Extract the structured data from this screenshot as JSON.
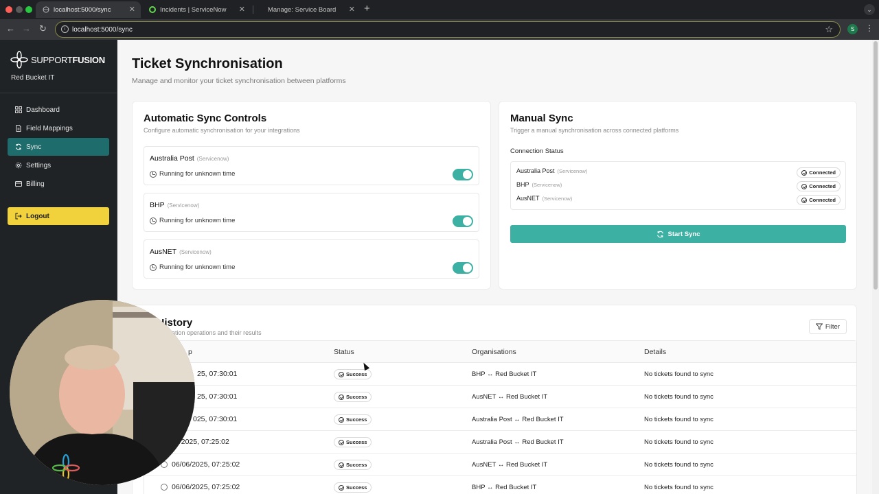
{
  "browser": {
    "tabs": [
      {
        "title": "localhost:5000/sync",
        "active": true
      },
      {
        "title": "Incidents | ServiceNow",
        "active": false
      },
      {
        "title": "Manage: Service Board",
        "active": false
      }
    ],
    "url": "localhost:5000/sync",
    "profile_initial": "S"
  },
  "sidebar": {
    "brand_light": "SUPPORT",
    "brand_bold": "FUSION",
    "org": "Red Bucket IT",
    "items": [
      {
        "label": "Dashboard",
        "icon": "grid-icon",
        "active": false
      },
      {
        "label": "Field Mappings",
        "icon": "document-icon",
        "active": false
      },
      {
        "label": "Sync",
        "icon": "refresh-icon",
        "active": true
      },
      {
        "label": "Settings",
        "icon": "gear-icon",
        "active": false
      },
      {
        "label": "Billing",
        "icon": "credit-card-icon",
        "active": false
      }
    ],
    "logout_label": "Logout"
  },
  "page": {
    "title": "Ticket Synchronisation",
    "subtitle": "Manage and monitor your ticket synchronisation between platforms"
  },
  "auto_sync": {
    "title": "Automatic Sync Controls",
    "subtitle": "Configure automatic synchronisation for your integrations",
    "integrations": [
      {
        "name": "Australia Post",
        "type": "(Servicenow)",
        "status": "Running for unknown time",
        "enabled": true
      },
      {
        "name": "BHP",
        "type": "(Servicenow)",
        "status": "Running for unknown time",
        "enabled": true
      },
      {
        "name": "AusNET",
        "type": "(Servicenow)",
        "status": "Running for unknown time",
        "enabled": true
      }
    ]
  },
  "manual_sync": {
    "title": "Manual Sync",
    "subtitle": "Trigger a manual synchronisation across connected platforms",
    "connection_label": "Connection Status",
    "connections": [
      {
        "name": "Australia Post",
        "type": "(Servicenow)",
        "status": "Connected"
      },
      {
        "name": "BHP",
        "type": "(Servicenow)",
        "status": "Connected"
      },
      {
        "name": "AusNET",
        "type": "(Servicenow)",
        "status": "Connected"
      }
    ],
    "start_label": "Start Sync"
  },
  "history": {
    "title": "c History",
    "subtitle": "nchronisation operations and their results",
    "filter_label": "Filter",
    "columns": [
      "p",
      "Status",
      "Organisations",
      "Details"
    ],
    "rows": [
      {
        "timestamp": "25, 07:30:01",
        "status": "Success",
        "orgs": "BHP ↔ Red Bucket IT",
        "details": "No tickets found to sync"
      },
      {
        "timestamp": "25, 07:30:01",
        "status": "Success",
        "orgs": "AusNET ↔ Red Bucket IT",
        "details": "No tickets found to sync"
      },
      {
        "timestamp": "025, 07:30:01",
        "status": "Success",
        "orgs": "Australia Post ↔ Red Bucket IT",
        "details": "No tickets found to sync"
      },
      {
        "timestamp": "6/2025, 07:25:02",
        "status": "Success",
        "orgs": "Australia Post ↔ Red Bucket IT",
        "details": "No tickets found to sync"
      },
      {
        "timestamp": "06/06/2025, 07:25:02",
        "status": "Success",
        "orgs": "AusNET ↔ Red Bucket IT",
        "details": "No tickets found to sync"
      },
      {
        "timestamp": "06/06/2025, 07:25:02",
        "status": "Success",
        "orgs": "BHP ↔ Red Bucket IT",
        "details": "No tickets found to sync"
      }
    ]
  },
  "colors": {
    "accent": "#3bb0a3",
    "sidebar_bg": "#1f2326",
    "active_nav": "#1f6c6c",
    "logout_bg": "#f1d23d"
  }
}
